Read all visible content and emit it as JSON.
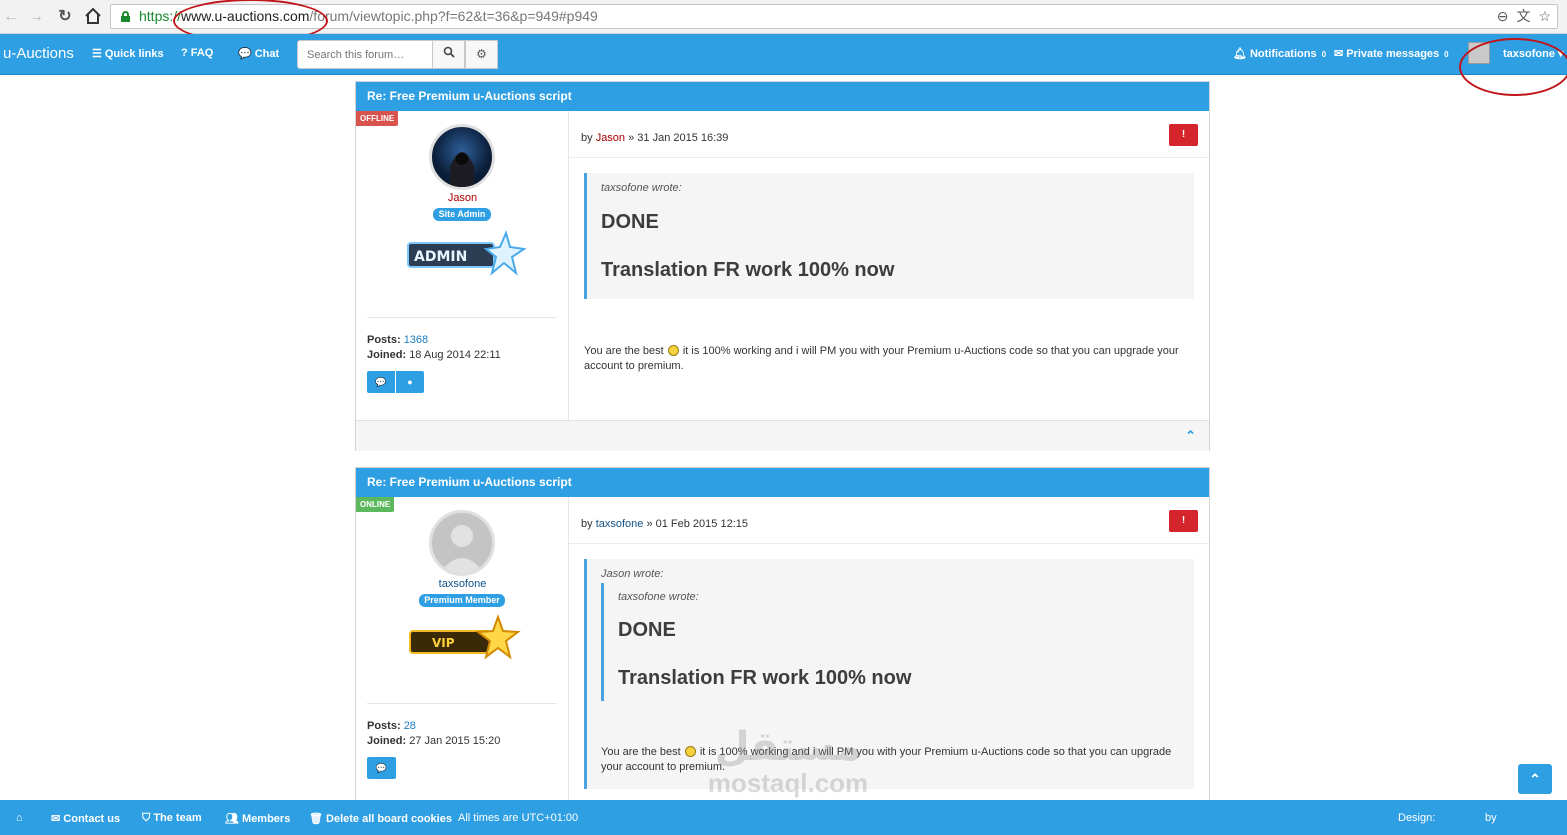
{
  "browser": {
    "url_protocol": "https://",
    "url_host": "www.u-auctions.com",
    "url_path": "/forum/viewtopic.php?f=62&t=36&p=949#p949",
    "back_icon": "back-arrow-icon",
    "forward_icon": "forward-arrow-icon",
    "reload_icon": "reload-icon",
    "home_icon": "home-icon"
  },
  "navbar": {
    "brand": "u-Auctions",
    "quick_links": "Quick links",
    "faq": "FAQ",
    "chat": "Chat",
    "search_placeholder": "Search this forum…",
    "notifications": "Notifications",
    "notifications_count": "0",
    "private_messages": "Private messages",
    "private_messages_count": "0",
    "username": "taxsofone"
  },
  "posts": [
    {
      "title": "Re: Free Premium u-Auctions script",
      "status": "OFFLINE",
      "author": "Jason",
      "rank": "Site Admin",
      "rank_image_text": "ADMIN",
      "posts_label": "Posts:",
      "posts_count": "1368",
      "joined_label": "Joined:",
      "joined": "18 Aug 2014 22:11",
      "by": "by",
      "date": "» 31 Jan 2015 16:39",
      "report": "!",
      "quote_cite": "taxsofone wrote:",
      "quote_line1": "DONE",
      "quote_line2": "Translation FR work 100% now",
      "text_before": "You are the best",
      "text_after": "it is 100% working and i will PM you with your Premium u-Auctions code so that you can upgrade your account to premium."
    },
    {
      "title": "Re: Free Premium u-Auctions script",
      "status": "ONLINE",
      "author": "taxsofone",
      "rank": "Premium Member",
      "rank_image_text": "VIP",
      "posts_label": "Posts:",
      "posts_count": "28",
      "joined_label": "Joined:",
      "joined": "27 Jan 2015 15:20",
      "by": "by",
      "date": "» 01 Feb 2015 12:15",
      "report": "!",
      "quote_cite": "Jason wrote:",
      "inner_quote_cite": "taxsofone wrote:",
      "quote_line1": "DONE",
      "quote_line2": "Translation FR work 100% now",
      "text_before": "You are the best",
      "text_after": "it is 100% working and i will PM you with your Premium u-Auctions code so that you can upgrade your account to premium."
    }
  ],
  "footer": {
    "contact": "Contact us",
    "team": "The team",
    "members": "Members",
    "delete_cookies": "Delete all board cookies",
    "timezone": "All times are UTC+01:00",
    "design": "Design:",
    "by": "by"
  },
  "watermark": {
    "line1": "مستقل",
    "line2": "mostaql.com"
  },
  "colors": {
    "accent": "#2f9fe3",
    "annotation": "#c0151a",
    "report": "#d3252b",
    "offline": "#d9534f",
    "online": "#5cb85c",
    "jason_name": "#aa0000",
    "taxsofone_name": "#105289"
  }
}
